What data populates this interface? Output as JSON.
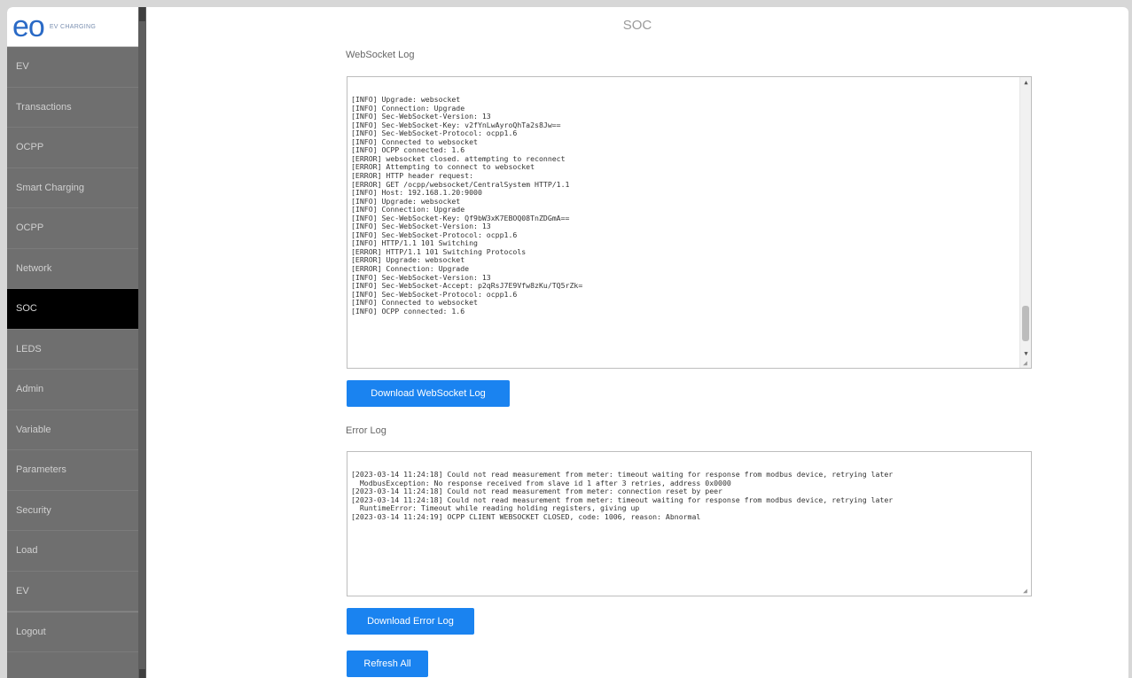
{
  "brand": {
    "logo_mark": "eo",
    "logo_tag": "EV CHARGING"
  },
  "sidebar": {
    "items": [
      {
        "label": "EV",
        "active": false
      },
      {
        "label": "Transactions",
        "active": false
      },
      {
        "label": "OCPP",
        "active": false
      },
      {
        "label": "Smart Charging",
        "active": false
      },
      {
        "label": "OCPP",
        "active": false
      },
      {
        "label": "Network",
        "active": false
      },
      {
        "label": "SOC",
        "active": true
      },
      {
        "label": "LEDS",
        "active": false
      },
      {
        "label": "Admin",
        "active": false
      },
      {
        "label": "Variable",
        "active": false
      },
      {
        "label": "Parameters",
        "active": false
      },
      {
        "label": "Security",
        "active": false
      },
      {
        "label": "Load",
        "active": false
      },
      {
        "label": "EV",
        "active": false
      },
      {
        "label": "Logout",
        "active": false
      }
    ]
  },
  "page": {
    "title": "SOC"
  },
  "websocket_log": {
    "label": "WebSocket Log",
    "lines": [
      "[INFO] Upgrade: websocket",
      "[INFO] Connection: Upgrade",
      "[INFO] Sec-WebSocket-Version: 13",
      "[INFO] Sec-WebSocket-Key: v2fYnLwAyroQhTa2s8Jw==",
      "[INFO] Sec-WebSocket-Protocol: ocpp1.6",
      "[INFO] Connected to websocket",
      "[INFO] OCPP connected: 1.6",
      "[ERROR] websocket closed. attempting to reconnect",
      "[ERROR] Attempting to connect to websocket",
      "[ERROR] HTTP header request:",
      "[ERROR] GET /ocpp/websocket/CentralSystem HTTP/1.1",
      "[INFO] Host: 192.168.1.20:9000",
      "[INFO] Upgrade: websocket",
      "[INFO] Connection: Upgrade",
      "[INFO] Sec-WebSocket-Key: Qf9bW3xK7EBOQ08TnZDGmA==",
      "[INFO] Sec-WebSocket-Version: 13",
      "[INFO] Sec-WebSocket-Protocol: ocpp1.6",
      "[INFO] HTTP/1.1 101 Switching",
      "[ERROR] HTTP/1.1 101 Switching Protocols",
      "[ERROR] Upgrade: websocket",
      "[ERROR] Connection: Upgrade",
      "[INFO] Sec-WebSocket-Version: 13",
      "[INFO] Sec-WebSocket-Accept: p2qRsJ7E9Vfw8zKu/TQ5rZk=",
      "[INFO] Sec-WebSocket-Protocol: ocpp1.6",
      "[INFO] Connected to websocket",
      "[INFO] OCPP connected: 1.6"
    ]
  },
  "buttons": {
    "download_websocket": "Download WebSocket Log",
    "download_error": "Download Error Log",
    "refresh_all": "Refresh All"
  },
  "error_log": {
    "label": "Error Log",
    "lines": [
      "[2023-03-14 11:24:18] Could not read measurement from meter: timeout waiting for response from modbus device, retrying later",
      "  ModbusException: No response received from slave id 1 after 3 retries, address 0x0000",
      "[2023-03-14 11:24:18] Could not read measurement from meter: connection reset by peer",
      "[2023-03-14 11:24:18] Could not read measurement from meter: timeout waiting for response from modbus device, retrying later",
      "  RuntimeError: Timeout while reading holding registers, giving up",
      "[2023-03-14 11:24:19] OCPP CLIENT WEBSOCKET CLOSED, code: 1006, reason: Abnormal"
    ]
  }
}
